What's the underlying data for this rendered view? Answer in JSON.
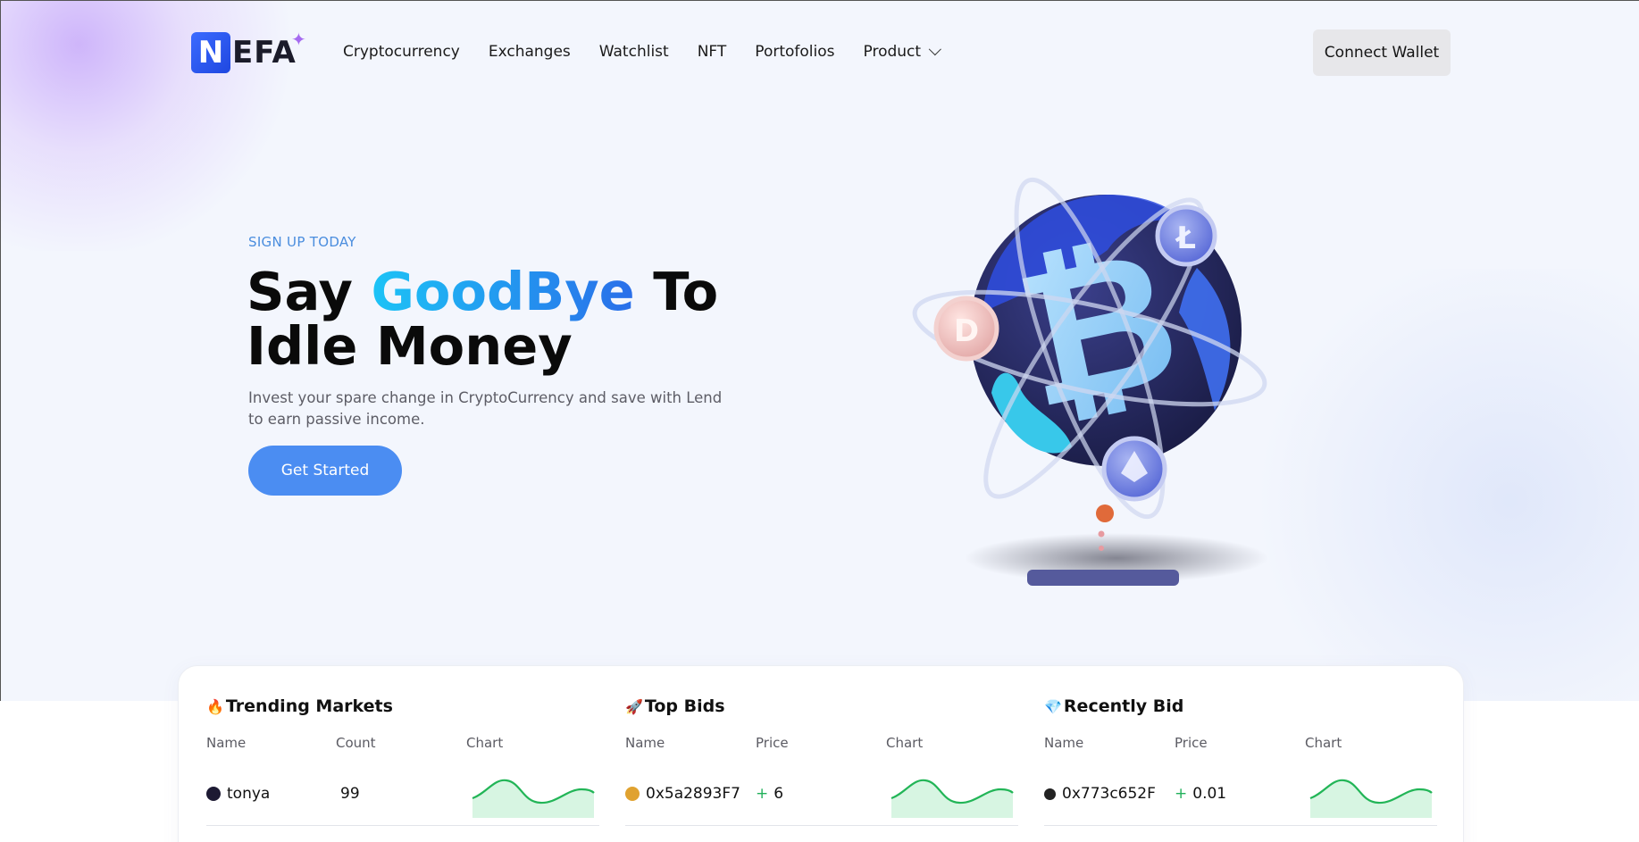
{
  "brand": {
    "logo_letter": "N",
    "logo_text": "EFA"
  },
  "nav": {
    "items": [
      "Cryptocurrency",
      "Exchanges",
      "Watchlist",
      "NFT",
      "Portofolios",
      "Product"
    ],
    "connect_label": "Connect Wallet"
  },
  "hero": {
    "eyebrow": "SIGN UP TODAY",
    "headline_pre": "Say ",
    "headline_accent": "GoodBye",
    "headline_post": " To Idle Money",
    "subtext": "Invest your spare change in CryptoCurrency and save with Lend to earn passive income.",
    "cta": "Get Started"
  },
  "markets": {
    "trending": {
      "emoji": "🔥",
      "title": "Trending Markets",
      "headers": [
        "Name",
        "Count",
        "Chart"
      ],
      "row": {
        "name": "tonya",
        "value": "99"
      }
    },
    "top_bids": {
      "emoji": "🚀",
      "title": "Top Bids",
      "headers": [
        "Name",
        "Price",
        "Chart"
      ],
      "row": {
        "name": "0x5a2893F7",
        "sign": "+",
        "value": "6"
      }
    },
    "recently_bid": {
      "emoji": "💎",
      "title": "Recently Bid",
      "headers": [
        "Name",
        "Price",
        "Chart"
      ],
      "row": {
        "name": "0x773c652F",
        "sign": "+",
        "value": "0.01"
      }
    }
  },
  "colors": {
    "accent": "#4b8df2",
    "gradient_start": "#1cc3f6",
    "gradient_end": "#2a6ee9",
    "positive": "#21b05a"
  }
}
